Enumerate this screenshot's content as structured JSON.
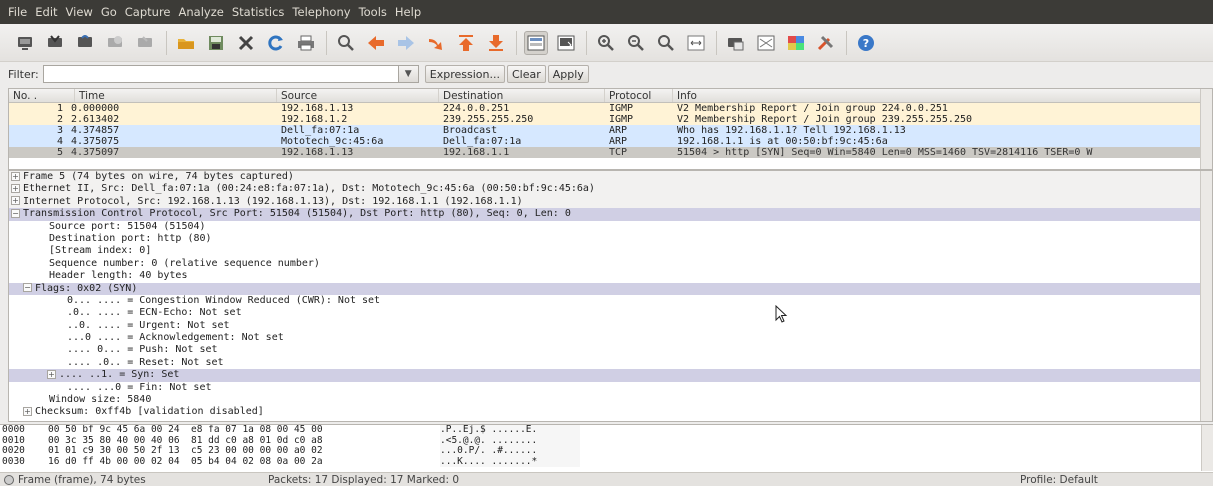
{
  "menu": [
    "File",
    "Edit",
    "View",
    "Go",
    "Capture",
    "Analyze",
    "Statistics",
    "Telephony",
    "Tools",
    "Help"
  ],
  "filter": {
    "label": "Filter:",
    "value": "",
    "expression_label": "Expression...",
    "clear_label": "Clear",
    "apply_label": "Apply"
  },
  "packet_list": {
    "columns": [
      "No. .",
      "Time",
      "Source",
      "Destination",
      "Protocol",
      "Info"
    ],
    "rows": [
      [
        "1",
        "0.000000",
        "192.168.1.13",
        "224.0.0.251",
        "IGMP",
        "V2 Membership Report / Join group 224.0.0.251"
      ],
      [
        "2",
        "2.613402",
        "192.168.1.2",
        "239.255.255.250",
        "IGMP",
        "V2 Membership Report / Join group 239.255.255.250"
      ],
      [
        "3",
        "4.374857",
        "Dell_fa:07:1a",
        "Broadcast",
        "ARP",
        "Who has 192.168.1.1?  Tell 192.168.1.13"
      ],
      [
        "4",
        "4.375075",
        "Mototech_9c:45:6a",
        "Dell_fa:07:1a",
        "ARP",
        "192.168.1.1 is at 00:50:bf:9c:45:6a"
      ],
      [
        "5",
        "4.375097",
        "192.168.1.13",
        "192.168.1.1",
        "TCP",
        "51504 > http [SYN] Seq=0 Win=5840 Len=0 MSS=1460 TSV=2814116 TSER=0 W"
      ]
    ]
  },
  "details": {
    "frame": "Frame 5 (74 bytes on wire, 74 bytes captured)",
    "ethernet": "Ethernet II, Src: Dell_fa:07:1a (00:24:e8:fa:07:1a), Dst: Mototech_9c:45:6a (00:50:bf:9c:45:6a)",
    "ip": "Internet Protocol, Src: 192.168.1.13 (192.168.1.13), Dst: 192.168.1.1 (192.168.1.1)",
    "tcp": "Transmission Control Protocol, Src Port: 51504 (51504), Dst Port: http (80), Seq: 0, Len: 0",
    "src_port": "Source port: 51504 (51504)",
    "dst_port": "Destination port: http (80)",
    "stream_index": "[Stream index: 0]",
    "seq": "Sequence number: 0    (relative sequence number)",
    "header_len": "Header length: 40 bytes",
    "flags": "Flags: 0x02 (SYN)",
    "flag_cwr": "0... .... = Congestion Window Reduced (CWR): Not set",
    "flag_ecn": ".0.. .... = ECN-Echo: Not set",
    "flag_urg": "..0. .... = Urgent: Not set",
    "flag_ack": "...0 .... = Acknowledgement: Not set",
    "flag_psh": ".... 0... = Push: Not set",
    "flag_rst": ".... .0.. = Reset: Not set",
    "flag_syn": ".... ..1. = Syn: Set",
    "flag_fin": ".... ...0 = Fin: Not set",
    "window": "Window size: 5840",
    "checksum": "Checksum: 0xff4b [validation disabled]"
  },
  "hex": [
    {
      "off": "0000",
      "bytes": "00 50 bf 9c 45 6a 00 24  e8 fa 07 1a 08 00 45 00",
      "ascii": ".P..Ej.$ ......E."
    },
    {
      "off": "0010",
      "bytes": "00 3c 35 80 40 00 40 06  81 dd c0 a8 01 0d c0 a8",
      "ascii": ".<5.@.@. ........"
    },
    {
      "off": "0020",
      "bytes": "01 01 c9 30 00 50 2f 13  c5 23 00 00 00 00 a0 02",
      "ascii": "...0.P/. .#......"
    },
    {
      "off": "0030",
      "bytes": "16 d0 ff 4b 00 00 02 04  05 b4 04 02 08 0a 00 2a",
      "ascii": "...K.... .......*"
    }
  ],
  "status": {
    "frame": "Frame (frame), 74 bytes",
    "packets": "Packets: 17 Displayed: 17 Marked: 0",
    "profile": "Profile: Default"
  }
}
